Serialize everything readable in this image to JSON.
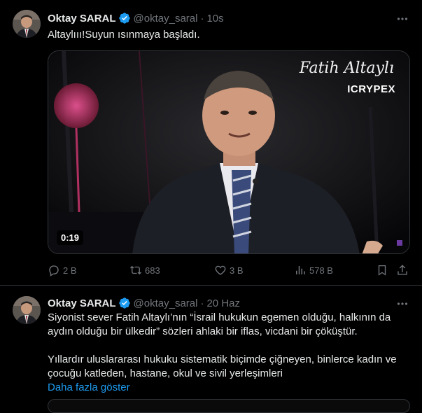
{
  "tweets": [
    {
      "author": {
        "name": "Oktay SARAL",
        "handle": "@oktay_saral",
        "verified": true
      },
      "time": "10s",
      "text": "Altaylııı!Suyun ısınmaya başladı.",
      "media": {
        "type": "video",
        "watermark_name": "Fatih Altaylı",
        "watermark_brand": "ICRYPEX",
        "duration": "0:19"
      },
      "stats": {
        "replies": "2 B",
        "retweets": "683",
        "likes": "3 B",
        "views": "578 B"
      }
    },
    {
      "author": {
        "name": "Oktay SARAL",
        "handle": "@oktay_saral",
        "verified": true
      },
      "time": "20 Haz",
      "lines": [
        "Siyonist sever Fatih Altaylı’nın “İsrail hukukun egemen olduğu, halkının da",
        "aydın olduğu bir ülkedir” sözleri ahlaki bir iflas, vicdani bir çöküştür.",
        "Yıllardır uluslararası hukuku sistematik biçimde çiğneyen, binlerce kadın ve",
        "çocuğu katleden, hastane, okul ve sivil yerleşimleri"
      ],
      "show_more": "Daha fazla göster"
    }
  ],
  "icons": {
    "verified": "verified-badge-icon",
    "more": "more-dots-icon",
    "reply": "reply-icon",
    "retweet": "retweet-icon",
    "like": "heart-icon",
    "views": "views-icon",
    "bookmark": "bookmark-icon",
    "share": "share-icon"
  },
  "colors": {
    "background": "#000000",
    "text": "#e7e9ea",
    "secondary": "#71767b",
    "accent": "#1d9bf0",
    "divider": "#2f3336"
  }
}
